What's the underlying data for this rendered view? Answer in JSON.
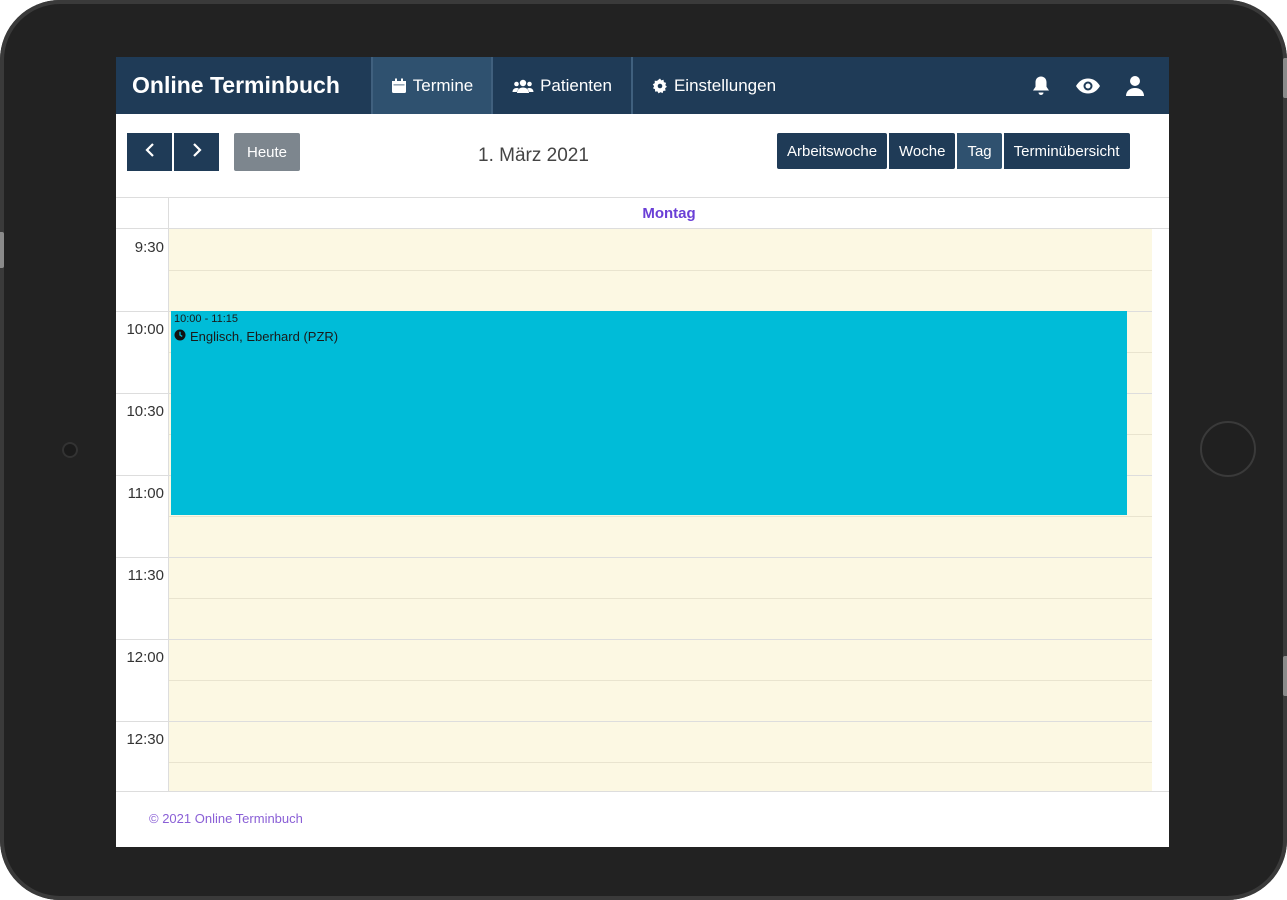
{
  "app": {
    "brand": "Online Terminbuch",
    "accent_color": "#1f3b57",
    "event_color": "#00bcd8",
    "slot_background": "#fcf8e3",
    "day_header_color": "#6a3fd6"
  },
  "navbar": {
    "items": [
      {
        "label": "Termine",
        "icon": "calendar-icon",
        "active": true
      },
      {
        "label": "Patienten",
        "icon": "users-icon",
        "active": false
      },
      {
        "label": "Einstellungen",
        "icon": "gear-icon",
        "active": false
      }
    ],
    "right_icons": [
      "bell-icon",
      "eye-icon",
      "user-icon"
    ]
  },
  "toolbar": {
    "prev_icon": "chevron-left-icon",
    "next_icon": "chevron-right-icon",
    "today_label": "Heute",
    "current_date": "1. März 2021",
    "views": [
      {
        "label": "Arbeitswoche",
        "active": false
      },
      {
        "label": "Woche",
        "active": false
      },
      {
        "label": "Tag",
        "active": true
      },
      {
        "label": "Terminübersicht",
        "active": false
      }
    ]
  },
  "calendar": {
    "day_header": "Montag",
    "time_labels": [
      "9:30",
      "10:00",
      "10:30",
      "11:00",
      "11:30",
      "12:00",
      "12:30"
    ],
    "events": [
      {
        "time": "10:00 - 11:15",
        "title": "Englisch, Eberhard (PZR)",
        "icon": "clock-icon"
      }
    ]
  },
  "footer": {
    "text": "© 2021 Online Terminbuch"
  }
}
